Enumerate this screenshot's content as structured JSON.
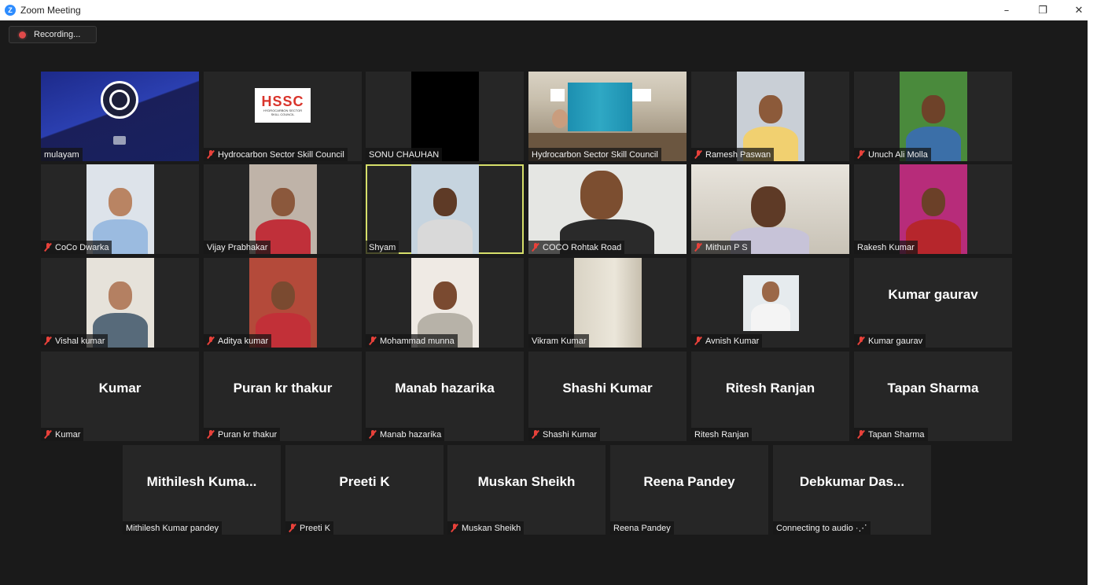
{
  "window": {
    "app_icon": "Z",
    "title": "Zoom Meeting",
    "minimize": "–",
    "restore": "❐",
    "close": "✕"
  },
  "recording": {
    "label": "Recording..."
  },
  "tiles": [
    {
      "label": "mulayam",
      "muted": false
    },
    {
      "label": "Hydrocarbon Sector Skill Council",
      "muted": true
    },
    {
      "label": "SONU CHAUHAN",
      "muted": false
    },
    {
      "label": "Hydrocarbon Sector Skill Council",
      "muted": false
    },
    {
      "label": "Ramesh Paswan",
      "muted": true
    },
    {
      "label": "Unuch Ali Molla",
      "muted": true
    },
    {
      "label": "CoCo Dwarka",
      "muted": true
    },
    {
      "label": "Vijay Prabhakar",
      "muted": false
    },
    {
      "label": "Shyam",
      "muted": false,
      "active": true
    },
    {
      "label": "COCO Rohtak Road",
      "muted": true
    },
    {
      "label": "Mithun P S",
      "muted": true
    },
    {
      "label": "Rakesh Kumar",
      "muted": false
    },
    {
      "label": "Vishal kumar",
      "muted": true
    },
    {
      "label": "Aditya kumar",
      "muted": true
    },
    {
      "label": "Mohammad munna",
      "muted": true
    },
    {
      "label": "Vikram Kumar",
      "muted": false
    },
    {
      "label": "Avnish Kumar",
      "muted": true
    },
    {
      "label": "Kumar gaurav",
      "center": "Kumar gaurav",
      "muted": true
    },
    {
      "label": "Kumar",
      "center": "Kumar",
      "muted": true
    },
    {
      "label": "Puran kr thakur",
      "center": "Puran kr thakur",
      "muted": true
    },
    {
      "label": "Manab hazarika",
      "center": "Manab hazarika",
      "muted": true
    },
    {
      "label": "Shashi Kumar",
      "center": "Shashi Kumar",
      "muted": true
    },
    {
      "label": "Ritesh Ranjan",
      "center": "Ritesh Ranjan",
      "muted": false
    },
    {
      "label": "Tapan Sharma",
      "center": "Tapan Sharma",
      "muted": true
    },
    {
      "label": "Mithilesh Kumar pandey",
      "center": "Mithilesh  Kuma...",
      "muted": false
    },
    {
      "label": "Preeti K",
      "center": "Preeti K",
      "muted": true
    },
    {
      "label": "Muskan Sheikh",
      "center": "Muskan Sheikh",
      "muted": true
    },
    {
      "label": "Reena Pandey",
      "center": "Reena Pandey",
      "muted": false
    },
    {
      "label": "Connecting to audio ·⋰",
      "center": "Debkumar  Das...",
      "muted": false
    }
  ],
  "hssc_logo_text": "HSSC",
  "hssc_logo_sub": "HYDROCARBON SECTOR SKILL COUNCIL",
  "colors": {
    "background": "#1a1a1a",
    "tile": "#262626",
    "active_border": "#d6df6a",
    "muted_icon": "#e8413a",
    "recording_dot": "#e04a4a"
  }
}
